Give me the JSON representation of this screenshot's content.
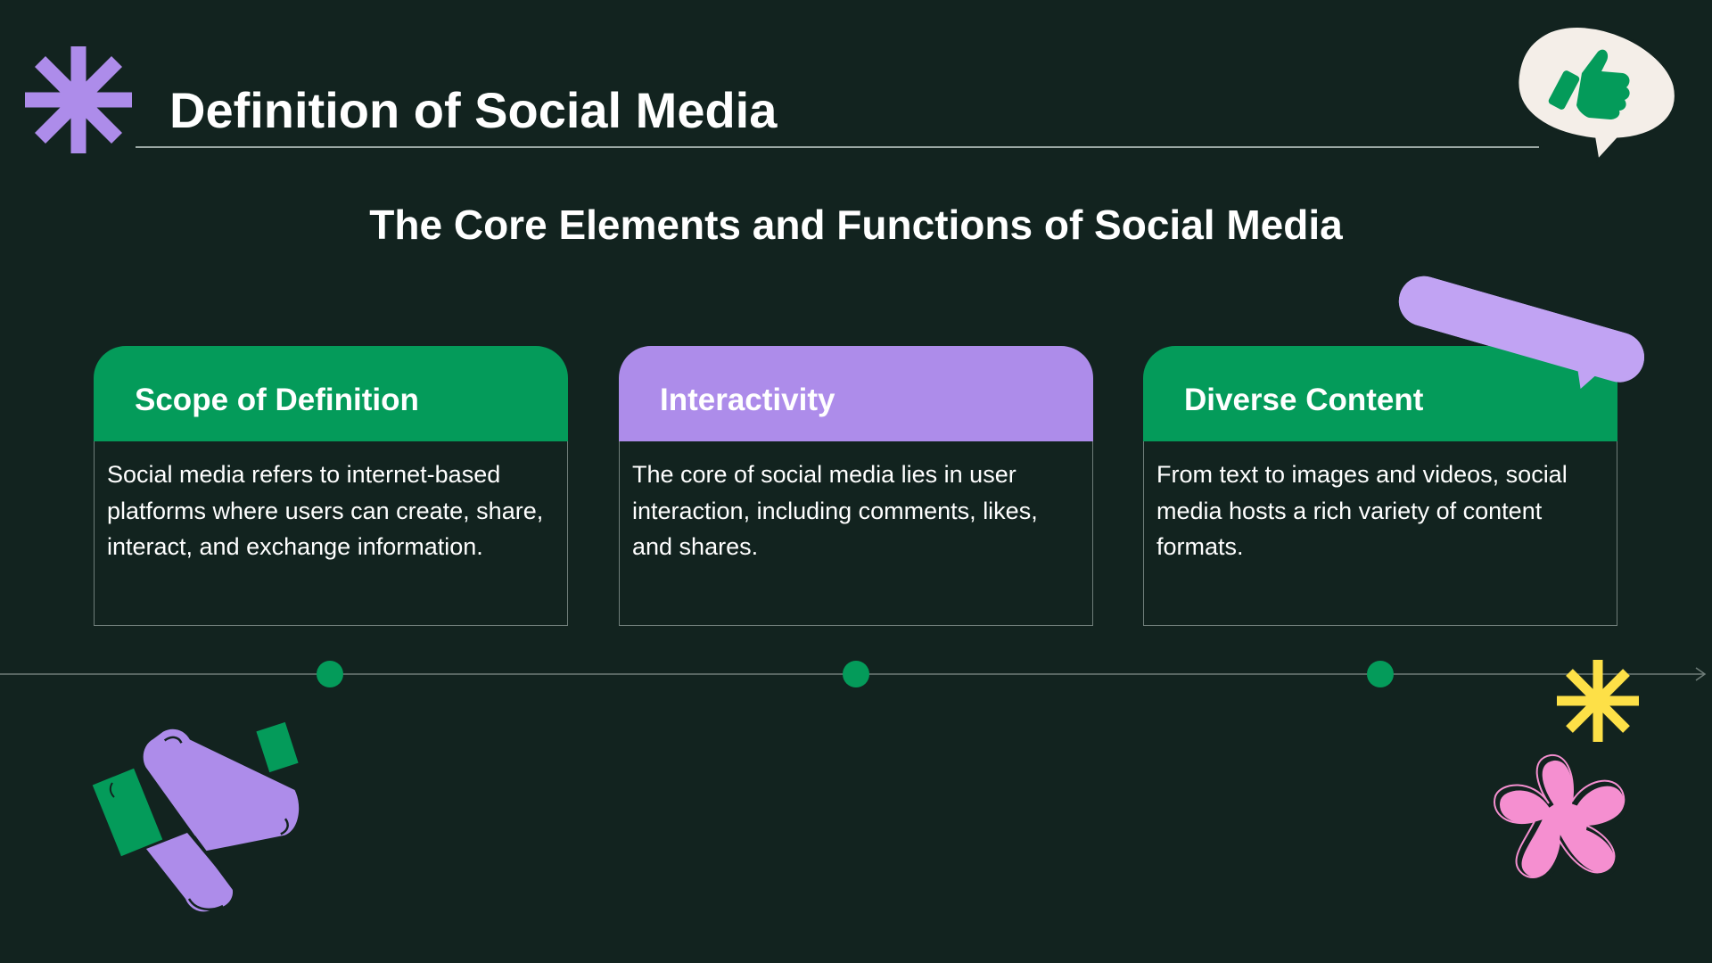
{
  "header": {
    "title": "Definition of Social Media"
  },
  "subtitle": "The Core Elements and Functions of Social Media",
  "cards": [
    {
      "heading": "Scope of Definition",
      "body": "Social media refers to internet-based platforms where users can create, share, interact, and exchange information.",
      "color": "#049b5a"
    },
    {
      "heading": "Interactivity",
      "body": "The core of social media lies in user interaction, including comments, likes, and shares.",
      "color": "#ad8cea"
    },
    {
      "heading": "Diverse Content",
      "body": "From text to images and videos, social media hosts a rich variety of content formats.",
      "color": "#049b5a"
    }
  ],
  "decorations": {
    "icons": [
      "asterisk-icon",
      "thumbs-up-bubble-icon",
      "speech-tag-icon",
      "megaphone-icon",
      "sparkle-icon",
      "flower-icon"
    ]
  },
  "colors": {
    "background": "#12231f",
    "green": "#049b5a",
    "purple": "#ad8cea",
    "yellow": "#fde047",
    "pink": "#f58fd0"
  }
}
